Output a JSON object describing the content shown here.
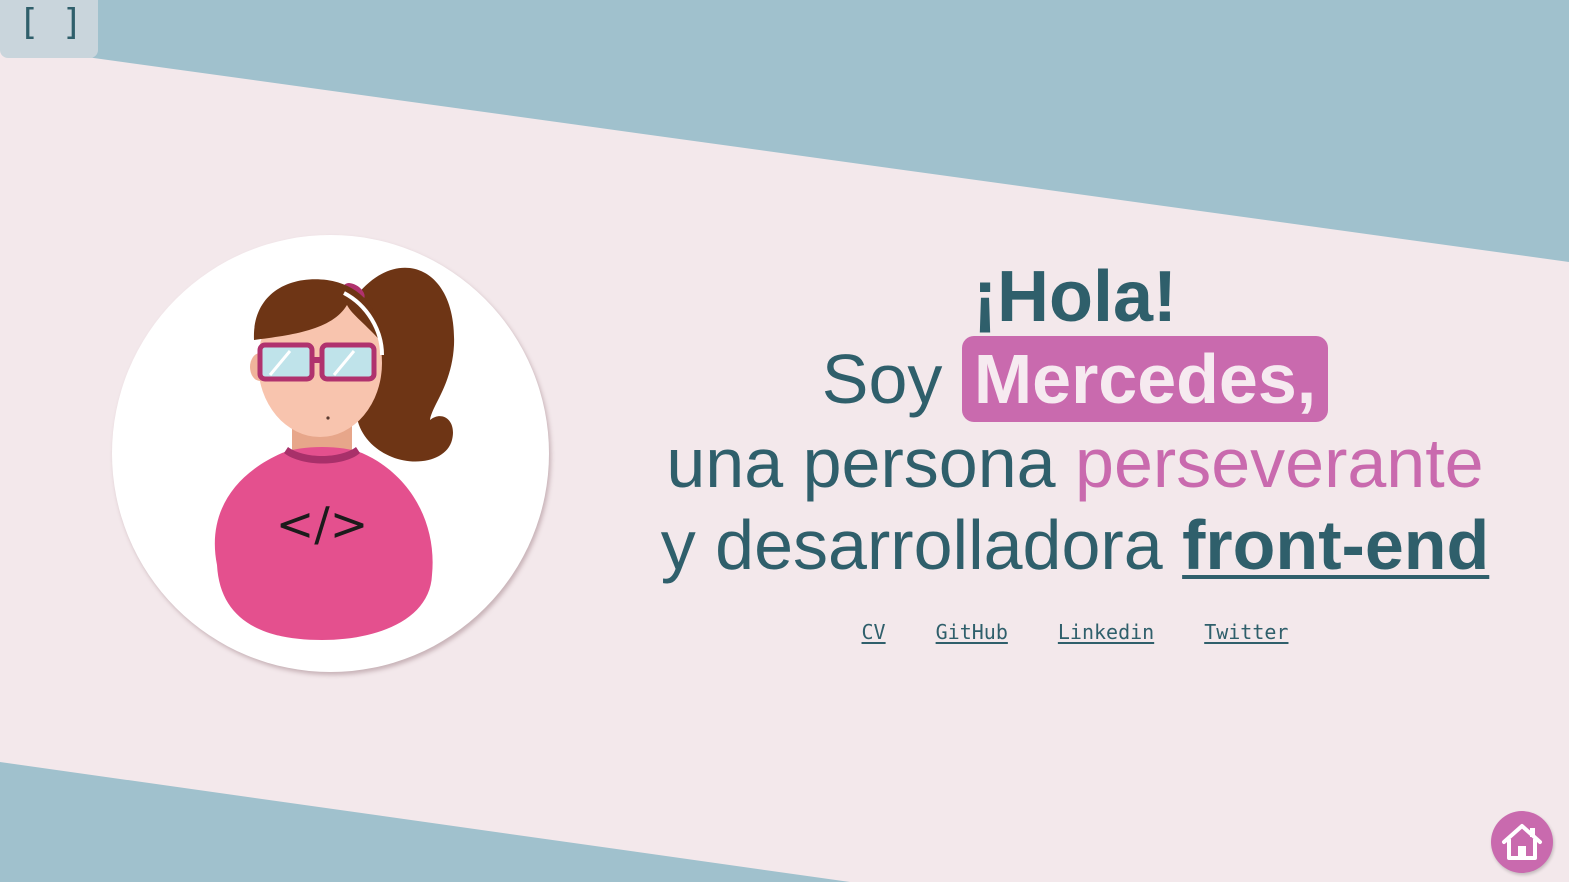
{
  "corner": {
    "brackets_text": "[ ]"
  },
  "hero": {
    "greeting": "¡Hola!",
    "line2_prefix": "Soy ",
    "name": "Mercedes,",
    "line3_prefix": "una persona ",
    "line3_accent": "perseverante",
    "line4_prefix": "y desarrolladora ",
    "line4_strong": "front-end"
  },
  "links": [
    {
      "label": "CV"
    },
    {
      "label": "GitHub"
    },
    {
      "label": "Linkedin"
    },
    {
      "label": "Twitter"
    }
  ],
  "avatar": {
    "shirt_symbol": "</>",
    "icon": "developer-avatar-illustration"
  },
  "home_button": {
    "icon": "home-icon"
  },
  "colors": {
    "background_blue": "#a0c1cd",
    "band_pink": "#f3e8eb",
    "text_teal": "#2f5f6b",
    "accent_pink": "#c96aae",
    "shirt_pink": "#e4508e",
    "hair_brown": "#6e3515"
  }
}
